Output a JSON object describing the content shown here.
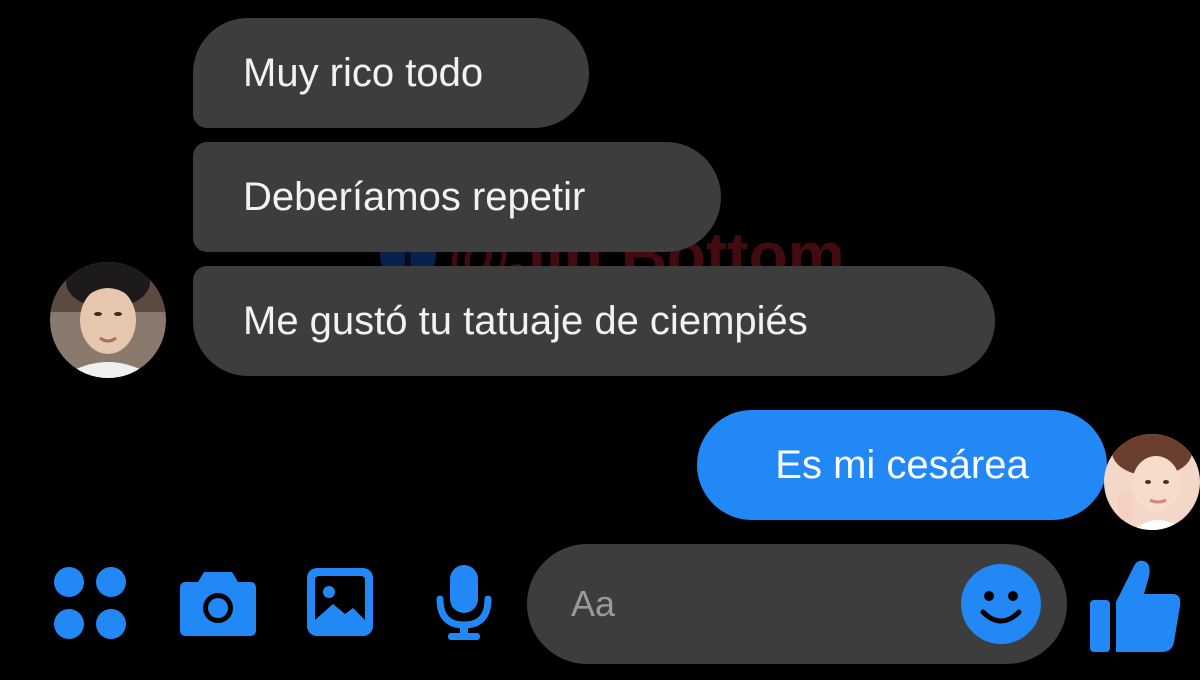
{
  "conversation": {
    "incoming_messages": [
      {
        "text": "Muy rico todo"
      },
      {
        "text": "Deberíamos repetir"
      },
      {
        "text": "Me gustó tu tatuaje de ciempiés"
      }
    ],
    "outgoing_messages": [
      {
        "text": "Es mi cesárea"
      }
    ]
  },
  "watermark": {
    "text": "@Jin Bottom",
    "icon": "facebook-icon"
  },
  "composer": {
    "icons": [
      "apps-icon",
      "camera-icon",
      "gallery-icon",
      "microphone-icon"
    ],
    "input_placeholder": "Aa",
    "emoji_icon": "smiley-icon",
    "like_icon": "thumbs-up-icon"
  },
  "colors": {
    "background": "#000000",
    "incoming_bubble": "#3d3d3d",
    "outgoing_bubble": "#2288f5",
    "accent_icon": "#2288f5",
    "text": "#f2f2f2"
  }
}
